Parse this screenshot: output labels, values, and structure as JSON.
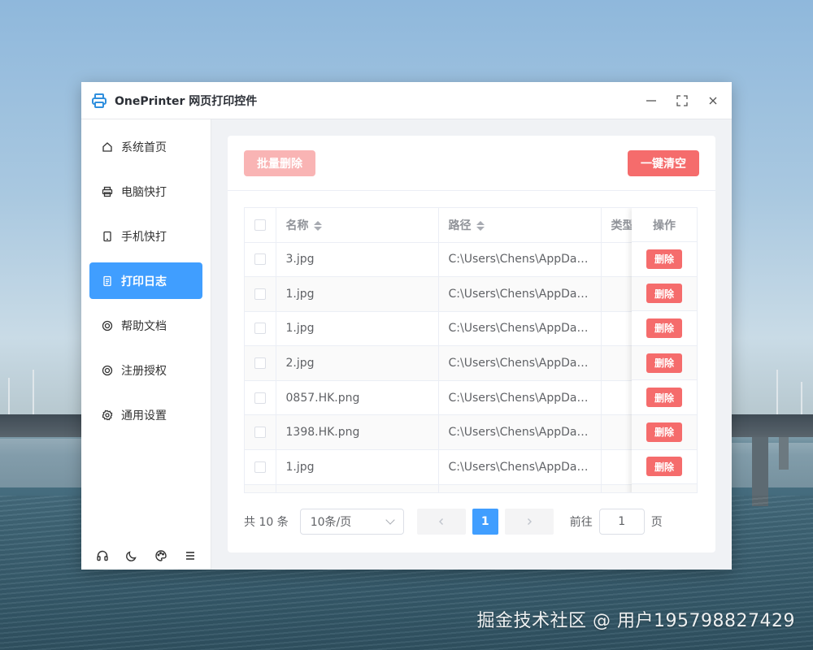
{
  "window": {
    "title": "OnePrinter 网页打印控件"
  },
  "sidebar": {
    "items": [
      {
        "label": "系统首页",
        "icon": "home-icon"
      },
      {
        "label": "电脑快打",
        "icon": "printer-icon"
      },
      {
        "label": "手机快打",
        "icon": "phone-icon"
      },
      {
        "label": "打印日志",
        "icon": "document-icon",
        "active": true
      },
      {
        "label": "帮助文档",
        "icon": "help-icon"
      },
      {
        "label": "注册授权",
        "icon": "license-icon"
      },
      {
        "label": "通用设置",
        "icon": "gear-icon"
      }
    ],
    "bottom_icons": [
      "headset-icon",
      "moon-icon",
      "palette-icon",
      "menu-icon"
    ]
  },
  "toolbar": {
    "batch_delete_label": "批量删除",
    "clear_all_label": "一键清空"
  },
  "table": {
    "columns": {
      "name": "名称",
      "path": "路径",
      "type": "类型",
      "action": "操作"
    },
    "delete_label": "删除",
    "rows": [
      {
        "name": "3.jpg",
        "path": "C:\\Users\\Chens\\AppData..."
      },
      {
        "name": "1.jpg",
        "path": "C:\\Users\\Chens\\AppData..."
      },
      {
        "name": "1.jpg",
        "path": "C:\\Users\\Chens\\AppData..."
      },
      {
        "name": "2.jpg",
        "path": "C:\\Users\\Chens\\AppData..."
      },
      {
        "name": "0857.HK.png",
        "path": "C:\\Users\\Chens\\AppData..."
      },
      {
        "name": "1398.HK.png",
        "path": "C:\\Users\\Chens\\AppData..."
      },
      {
        "name": "1.jpg",
        "path": "C:\\Users\\Chens\\AppData..."
      }
    ]
  },
  "pagination": {
    "total": "共 10 条",
    "page_size": "10条/页",
    "current_page": "1",
    "goto_label": "前往",
    "goto_value": "1",
    "page_suffix": "页"
  },
  "watermark": "掘金技术社区 @ 用户195798827429",
  "colors": {
    "primary": "#409eff",
    "danger": "#f56c6c",
    "danger_disabled": "#f9b4b4"
  }
}
